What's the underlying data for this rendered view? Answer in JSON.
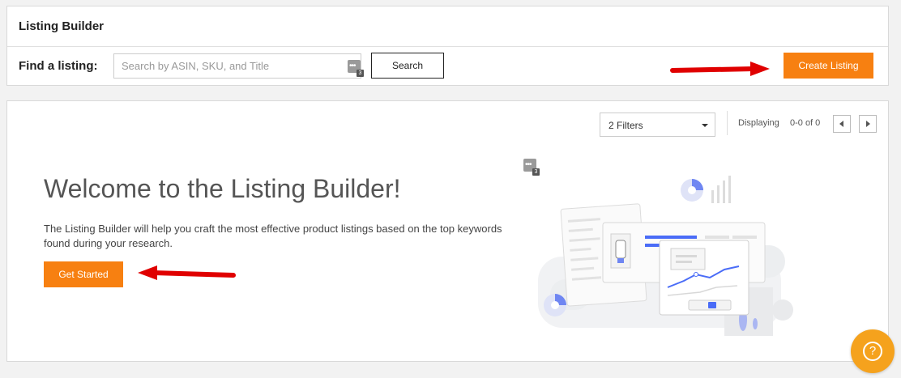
{
  "header": {
    "title": "Listing Builder"
  },
  "search": {
    "label": "Find a listing:",
    "placeholder": "Search by ASIN, SKU, and Title",
    "value": "",
    "button_label": "Search",
    "badge_count": "3"
  },
  "toolbar": {
    "create_label": "Create Listing"
  },
  "filters": {
    "selected": "2 Filters",
    "displaying_label": "Displaying",
    "displaying_count": "0-0  of 0"
  },
  "welcome": {
    "heading": "Welcome to the Listing Builder!",
    "description": "The Listing Builder will help you craft the most effective product listings based on the top keywords found during your research.",
    "cta_label": "Get Started",
    "badge_count": "3"
  },
  "help": {
    "icon": "?"
  },
  "icons": {
    "more": "more-dots-icon",
    "caret": "chevron-down-icon",
    "prev": "chevron-left-icon",
    "next": "chevron-right-icon",
    "help": "question-icon",
    "arrow": "red-arrow-icon"
  },
  "colors": {
    "accent": "#f78011",
    "help": "#f5a21d",
    "annotation_arrow": "#e00000",
    "illustration_blue": "#4a6cf7"
  }
}
